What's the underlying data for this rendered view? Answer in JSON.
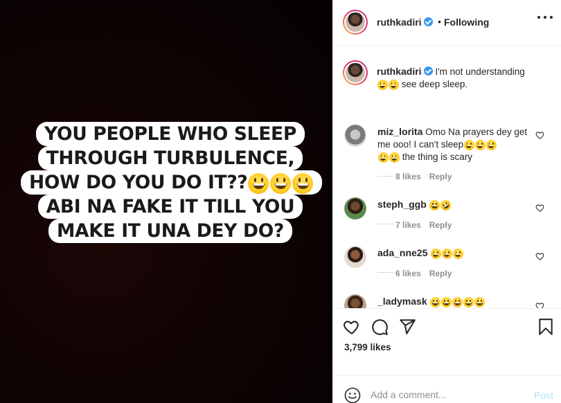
{
  "post_image": {
    "lines": [
      "YOU PEOPLE WHO  SLEEP",
      "THROUGH TURBULENCE,",
      "HOW DO YOU DO IT??",
      "ABI NA FAKE IT TILL YOU",
      "MAKE IT UNA DEY DO?"
    ],
    "emoji": "grinning-face"
  },
  "header": {
    "username": "ruthkadiri",
    "dot": "•",
    "follow_status": "Following",
    "more_icon": "more-horizontal-icon"
  },
  "caption": {
    "username": "ruthkadiri",
    "text_1": "I'm not understanding",
    "text_2": "see deep sleep."
  },
  "comments": [
    {
      "username": "miz_lorita",
      "text_1": "Omo Na prayers dey get me ooo! I can't sleep",
      "text_2": "the thing is scary",
      "likes": "8 likes",
      "reply": "Reply"
    },
    {
      "username": "steph_ggb",
      "text_1": "",
      "likes": "7 likes",
      "reply": "Reply"
    },
    {
      "username": "ada_nne25",
      "text_1": "",
      "likes": "6 likes",
      "reply": "Reply"
    },
    {
      "username": "_ladymask",
      "text_1": ""
    }
  ],
  "actions": {
    "like_icon": "heart-icon",
    "comment_icon": "comment-icon",
    "share_icon": "send-icon",
    "save_icon": "bookmark-icon",
    "likes_count": "3,799 likes"
  },
  "add_comment": {
    "placeholder": "Add a comment...",
    "post_label": "Post"
  }
}
